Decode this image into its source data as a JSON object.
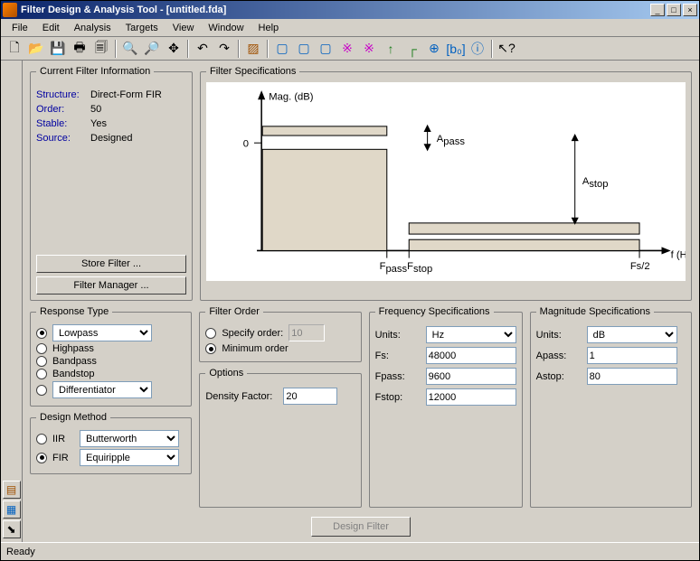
{
  "window": {
    "title": "Filter Design & Analysis Tool - [untitled.fda]"
  },
  "menu": {
    "file": "File",
    "edit": "Edit",
    "analysis": "Analysis",
    "targets": "Targets",
    "view": "View",
    "window": "Window",
    "help": "Help"
  },
  "filter_info": {
    "legend": "Current Filter Information",
    "structure_k": "Structure:",
    "structure_v": "Direct-Form FIR",
    "order_k": "Order:",
    "order_v": "50",
    "stable_k": "Stable:",
    "stable_v": "Yes",
    "source_k": "Source:",
    "source_v": "Designed",
    "store_btn": "Store Filter ...",
    "manager_btn": "Filter Manager ..."
  },
  "spec": {
    "legend": "Filter Specifications",
    "ylabel": "Mag. (dB)",
    "xlabel": "f  (Hz)",
    "zero": "0",
    "fpass_lbl": "F",
    "fpass_sub": "pass",
    "fstop_lbl": "F",
    "fstop_sub": "stop",
    "fs2": "Fs/2",
    "apass_lbl": "A",
    "apass_sub": "pass",
    "astop_lbl": "A",
    "astop_sub": "stop"
  },
  "response_type": {
    "legend": "Response Type",
    "lowpass": "Lowpass",
    "highpass": "Highpass",
    "bandpass": "Bandpass",
    "bandstop": "Bandstop",
    "differentiator": "Differentiator"
  },
  "design_method": {
    "legend": "Design Method",
    "iir": "IIR",
    "iir_sel": "Butterworth",
    "fir": "FIR",
    "fir_sel": "Equiripple"
  },
  "filter_order": {
    "legend": "Filter Order",
    "specify": "Specify order:",
    "specify_val": "10",
    "minimum": "Minimum order"
  },
  "options": {
    "legend": "Options",
    "density_k": "Density Factor:",
    "density_v": "20"
  },
  "freq_spec": {
    "legend": "Frequency Specifications",
    "units_k": "Units:",
    "units_v": "Hz",
    "fs_k": "Fs:",
    "fs_v": "48000",
    "fpass_k": "Fpass:",
    "fpass_v": "9600",
    "fstop_k": "Fstop:",
    "fstop_v": "12000"
  },
  "mag_spec": {
    "legend": "Magnitude Specifications",
    "units_k": "Units:",
    "units_v": "dB",
    "apass_k": "Apass:",
    "apass_v": "1",
    "astop_k": "Astop:",
    "astop_v": "80"
  },
  "design_btn": "Design Filter",
  "status": "Ready"
}
